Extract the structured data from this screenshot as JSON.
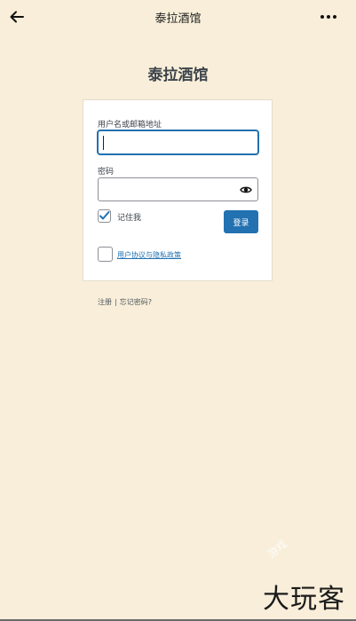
{
  "topbar": {
    "title": "泰拉酒馆",
    "back_icon": "arrow-left-icon",
    "more_icon": "more-horizontal-icon"
  },
  "site": {
    "name": "泰拉酒馆"
  },
  "login_form": {
    "username_label": "用户名或邮箱地址",
    "username_value": "",
    "password_label": "密码",
    "password_value": "",
    "remember_label": "记住我",
    "remember_checked": true,
    "submit_label": "登录",
    "policy_checked": false,
    "policy_link": "用户协议与隐私政策"
  },
  "footer": {
    "register": "注册",
    "separator": "|",
    "forgot": "忘记密码?"
  },
  "watermark": {
    "text": "大玩客",
    "faint_text": "游戏"
  },
  "colors": {
    "background": "#f8eed9",
    "accent": "#2271b1"
  }
}
